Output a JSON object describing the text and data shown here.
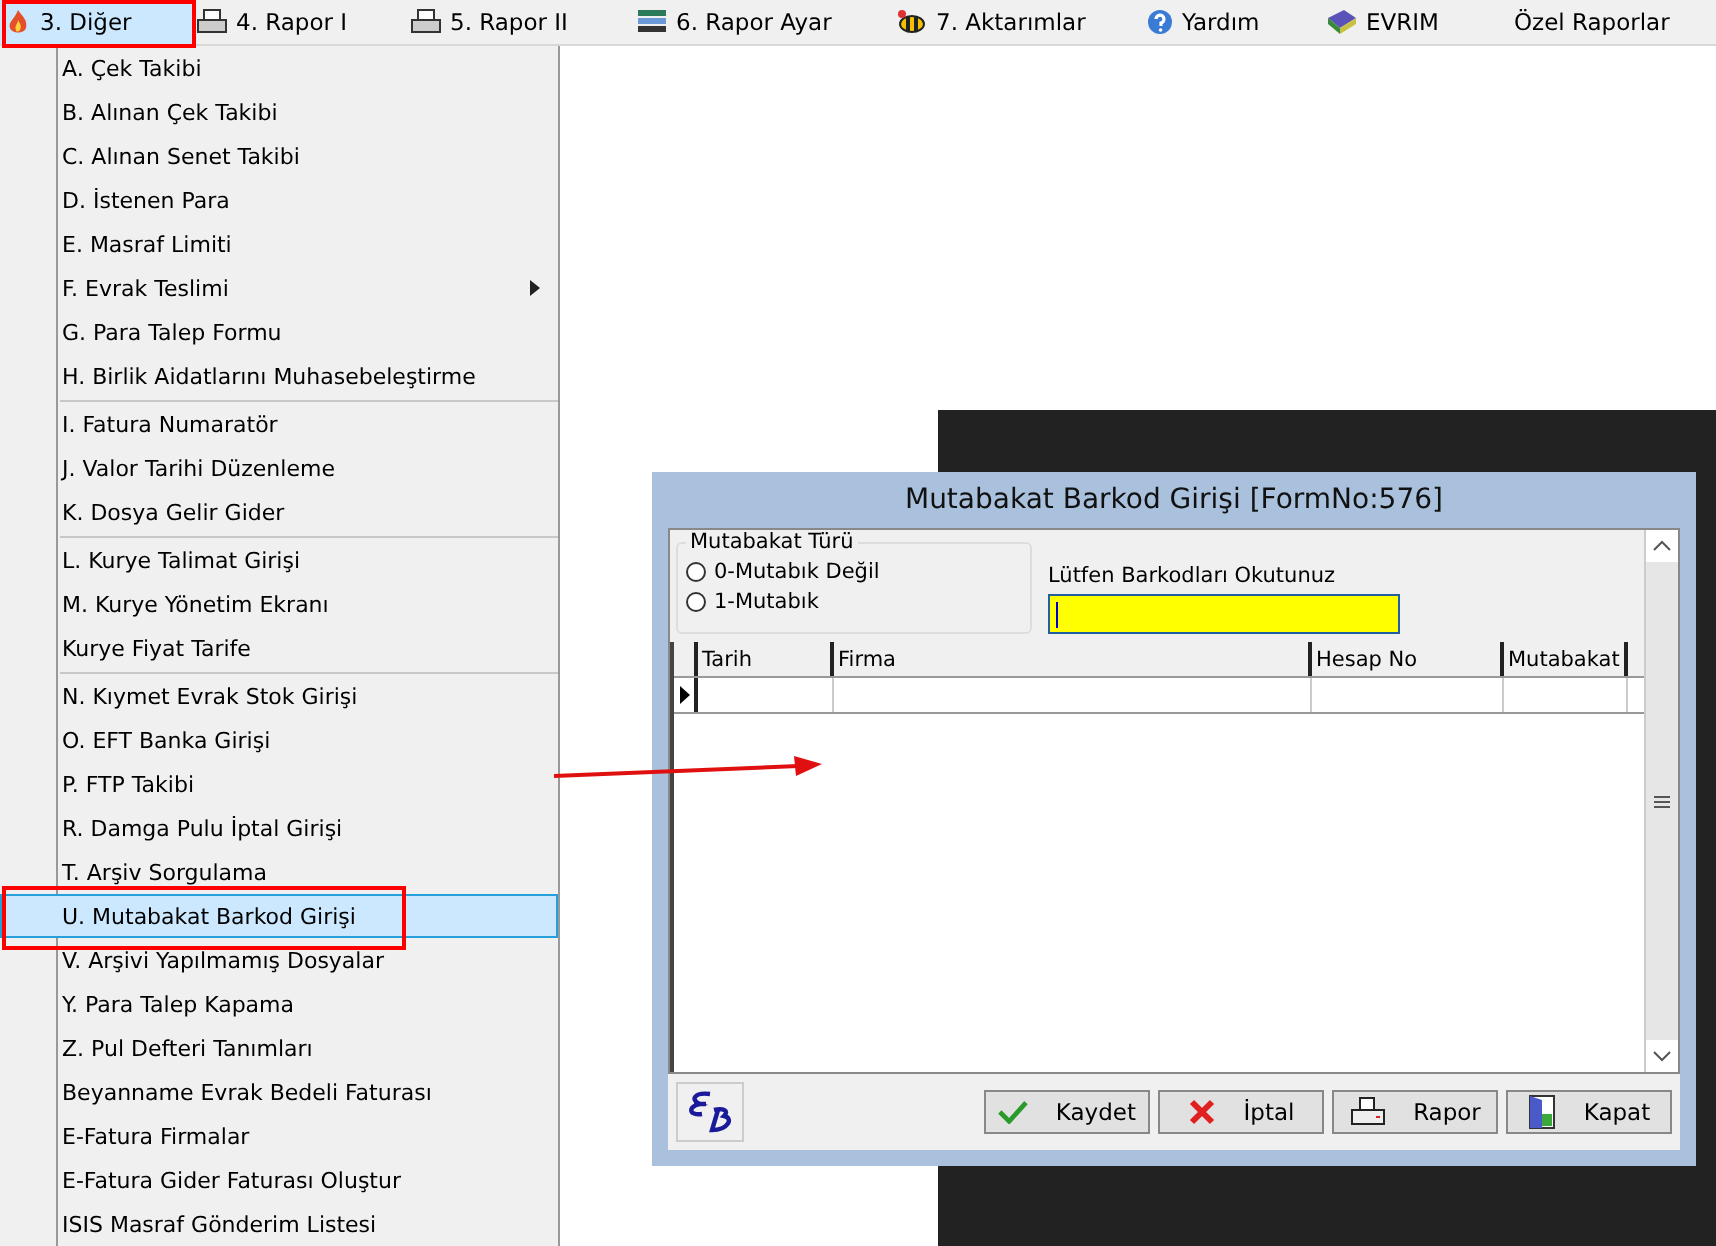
{
  "menubar": [
    {
      "label": "3.  Diğer",
      "selected": true
    },
    {
      "label": "4.  Rapor I",
      "selected": false
    },
    {
      "label": "5.  Rapor II",
      "selected": false
    },
    {
      "label": "6.  Rapor Ayar",
      "selected": false
    },
    {
      "label": "7.  Aktarımlar",
      "selected": false
    },
    {
      "label": "Yardım",
      "selected": false
    },
    {
      "label": "EVRIM",
      "selected": false
    },
    {
      "label": "Özel Raporlar",
      "selected": false
    }
  ],
  "dropdown": {
    "groups": [
      [
        {
          "label": "A.  Çek Takibi",
          "selected": false,
          "submenu": false
        },
        {
          "label": "B.  Alınan Çek Takibi",
          "selected": false,
          "submenu": false
        },
        {
          "label": "C.  Alınan Senet Takibi",
          "selected": false,
          "submenu": false
        },
        {
          "label": "D.  İstenen Para",
          "selected": false,
          "submenu": false
        },
        {
          "label": "E.  Masraf Limiti",
          "selected": false,
          "submenu": false
        },
        {
          "label": "F.  Evrak Teslimi",
          "selected": false,
          "submenu": true
        },
        {
          "label": "G.  Para Talep Formu",
          "selected": false,
          "submenu": false
        },
        {
          "label": "H.  Birlik Aidatlarını Muhasebeleştirme",
          "selected": false,
          "submenu": false
        }
      ],
      [
        {
          "label": "I.  Fatura Numaratör",
          "selected": false,
          "submenu": false
        },
        {
          "label": "J.  Valor Tarihi Düzenleme",
          "selected": false,
          "submenu": false
        },
        {
          "label": "K.  Dosya Gelir Gider",
          "selected": false,
          "submenu": false
        }
      ],
      [
        {
          "label": "L.   Kurye Talimat Girişi",
          "selected": false,
          "submenu": false
        },
        {
          "label": "M.  Kurye Yönetim Ekranı",
          "selected": false,
          "submenu": false
        },
        {
          "label": "Kurye Fiyat Tarife",
          "selected": false,
          "submenu": false
        }
      ],
      [
        {
          "label": "N.  Kıymet Evrak Stok Girişi",
          "selected": false,
          "submenu": false
        },
        {
          "label": "O.  EFT Banka Girişi",
          "selected": false,
          "submenu": false
        },
        {
          "label": "P.   FTP Takibi",
          "selected": false,
          "submenu": false
        },
        {
          "label": "R.  Damga Pulu İptal  Girişi",
          "selected": false,
          "submenu": false
        },
        {
          "label": "T. Arşiv Sorgulama",
          "selected": false,
          "submenu": false
        },
        {
          "label": "U. Mutabakat Barkod Girişi",
          "selected": true,
          "submenu": false
        },
        {
          "label": "V. Arşivi Yapılmamış Dosyalar",
          "selected": false,
          "submenu": false
        },
        {
          "label": "Y.  Para Talep Kapama",
          "selected": false,
          "submenu": false
        },
        {
          "label": "Z. Pul Defteri Tanımları",
          "selected": false,
          "submenu": false
        },
        {
          "label": "Beyanname Evrak Bedeli Faturası",
          "selected": false,
          "submenu": false
        },
        {
          "label": "E-Fatura Firmalar",
          "selected": false,
          "submenu": false
        },
        {
          "label": "E-Fatura Gider Faturası Oluştur",
          "selected": false,
          "submenu": false
        },
        {
          "label": "ISIS Masraf Gönderim Listesi",
          "selected": false,
          "submenu": false
        }
      ]
    ]
  },
  "dialog": {
    "title": "Mutabakat Barkod Girişi [FormNo:576]",
    "type_group": {
      "title": "Mutabakat Türü",
      "options": [
        {
          "label": "0-Mutabık Değil",
          "selected": false
        },
        {
          "label": "1-Mutabık",
          "selected": false
        }
      ]
    },
    "barcode": {
      "label": "Lütfen Barkodları Okutunuz"
    },
    "table": {
      "columns": [
        "Tarih",
        "Firma",
        "Hesap No",
        "Mutabakat"
      ]
    },
    "buttons": [
      {
        "label": "Kaydet"
      },
      {
        "label": "İptal"
      },
      {
        "label": "Rapor"
      },
      {
        "label": "Kapat"
      }
    ]
  }
}
